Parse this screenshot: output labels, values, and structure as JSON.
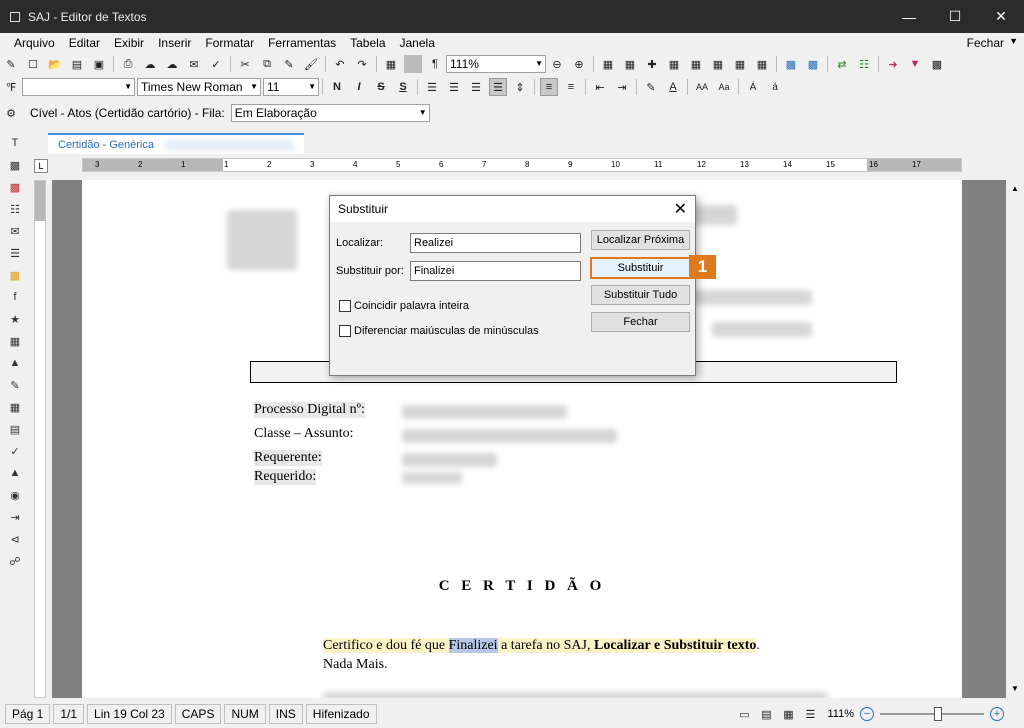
{
  "window": {
    "title": "SAJ - Editor de Textos"
  },
  "menu": {
    "items": [
      "Arquivo",
      "Editar",
      "Exibir",
      "Inserir",
      "Formatar",
      "Ferramentas",
      "Tabela",
      "Janela"
    ],
    "close_label": "Fechar"
  },
  "toolbar1": {
    "zoom": "111%",
    "pilcrow": "¶"
  },
  "toolbar2": {
    "font": "Times New Roman",
    "size": "11",
    "bold": "N",
    "italic": "I",
    "strike": "S",
    "underline": "S"
  },
  "toolbar3": {
    "context": "Cível - Atos (Certidão cartório) - Fila:",
    "queue": "Em Elaboração"
  },
  "tab": {
    "label": "Certidão - Genérica"
  },
  "ruler": {
    "labels": [
      "3",
      "2",
      "1",
      "1",
      "2",
      "3",
      "4",
      "5",
      "6",
      "7",
      "8",
      "9",
      "10",
      "11",
      "12",
      "13",
      "14",
      "15",
      "16",
      "17"
    ]
  },
  "document": {
    "box_heading": "CERTIDÃO",
    "fields": [
      "Processo Digital nº:",
      "Classe – Assunto:",
      "Requerente:",
      "Requerido:"
    ],
    "heading": "C E R T I D Ã O",
    "para": {
      "part1": "Certifico e dou fé que ",
      "selected": "Finalizei",
      "part2": " a tarefa no SAJ, ",
      "bold": "Localizar e Substituir texto",
      "end": "."
    },
    "line2": "Nada Mais."
  },
  "dialog": {
    "title": "Substituir",
    "find_label": "Localizar:",
    "find_value": "Realizei",
    "replace_label": "Substituir por:",
    "replace_value": "Finalizei",
    "whole_word": "Coincidir palavra inteira",
    "match_case": "Diferenciar maiúsculas de minúsculas",
    "btn_find_next": "Localizar Próxima",
    "btn_replace": "Substituir",
    "btn_replace_all": "Substituir Tudo",
    "btn_close": "Fechar",
    "callout": "1"
  },
  "status": {
    "page": "Pág 1",
    "pages": "1/1",
    "position": "Lin 19  Col 23",
    "caps": "CAPS",
    "num": "NUM",
    "ins": "INS",
    "hyphen": "Hifenizado",
    "zoom": "111%"
  },
  "colors": {
    "accent": "#e07a1f",
    "tab_blue": "#2a6ebb",
    "selection": "#b8c6e8"
  }
}
